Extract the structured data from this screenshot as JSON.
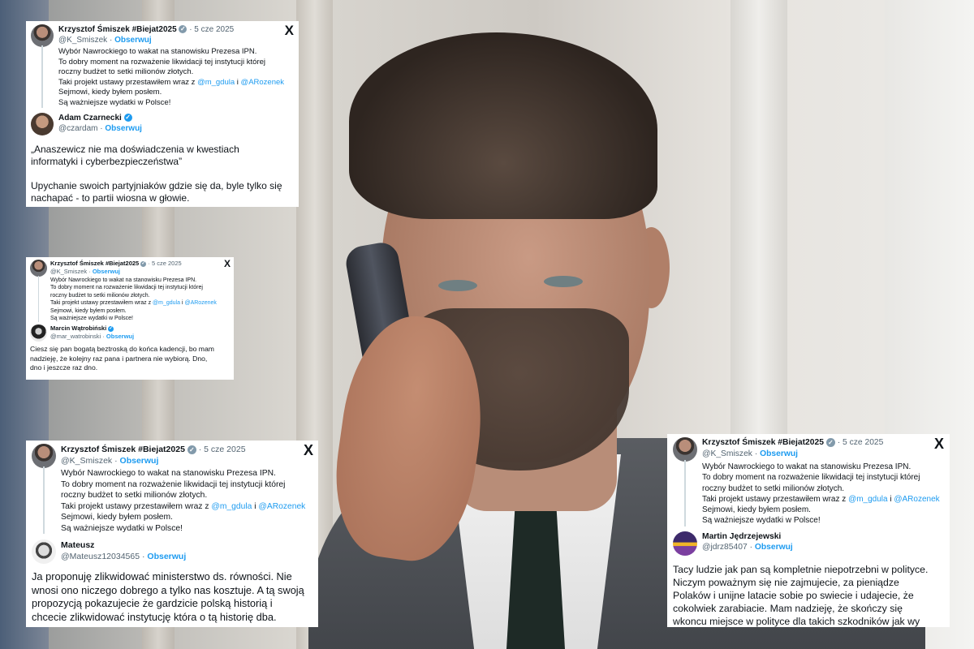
{
  "original_tweet": {
    "author": "Krzysztof Śmiszek #Biejat2025",
    "handle": "@K_Smiszek",
    "follow": "Obserwuj",
    "date": "5 cze 2025",
    "lines": [
      "Wybór Nawrockiego to wakat na stanowisku Prezesa IPN.",
      "To dobry moment na rozważenie likwidacji tej instytucji której",
      "roczny budżet to setki milionów złotych.",
      "Sejmowi, kiedy byłem posłem.",
      "Są ważniejsze wydatki w Polsce!"
    ],
    "mention_line": {
      "prefix": "Taki projekt ustawy przestawiłem wraz z ",
      "mention1": "@m_gdula",
      "joiner": " i ",
      "mention2": "@ARozenek"
    }
  },
  "cards": [
    {
      "reply_author": "Adam Czarnecki",
      "reply_handle": "@czardam",
      "reply_follow": "Obserwuj",
      "reply_text": [
        "„Anaszewicz nie ma doświadczenia w kwestiach",
        "informatyki i cyberbezpieczeństwa”",
        "",
        "Upychanie swoich partyjniaków gdzie się da, byle tylko się",
        "nachapać - to partii wiosna w głowie."
      ]
    },
    {
      "reply_author": "Marcin Wątrobiński",
      "reply_handle": "@mar_watrobinski",
      "reply_follow": "Obserwuj",
      "reply_text": [
        "Ciesz się pan bogatą beztroską do końca kadencji, bo mam",
        "nadzieję, że kolejny raz pana i partnera nie wybiorą. Dno,",
        "dno i jeszcze raz dno."
      ]
    },
    {
      "reply_author": "Mateusz",
      "reply_handle": "@Mateusz12034565",
      "reply_follow": "Obserwuj",
      "reply_text": [
        "Ja proponuję zlikwidować ministerstwo ds. równości. Nie",
        "wnosi ono niczego dobrego a tylko nas kosztuje. A tą swoją",
        "propozycją pokazujecie że gardzicie polską historią i",
        "chcecie zlikwidować instytucję która o tą historię dba."
      ]
    },
    {
      "reply_author": "Martin Jędrzejewski",
      "reply_handle": "@jdrz85407",
      "reply_follow": "Obserwuj",
      "reply_text": [
        "Tacy ludzie jak pan są kompletnie niepotrzebni w polityce.",
        "Niczym poważnym się nie zajmujecie, za pieniądze",
        "Polaków i unijne latacie sobie po swiecie i udajecie, że",
        "cokolwiek zarabiacie. Mam nadzieję, że skończy się",
        "wkoncu miejsce w polityce dla takich szkodników jak wy"
      ]
    }
  ],
  "icons": {
    "x_logo": "X",
    "verified": "✓"
  },
  "colors": {
    "accent": "#1d9bf0",
    "text": "#0f1419",
    "muted": "#536471"
  }
}
